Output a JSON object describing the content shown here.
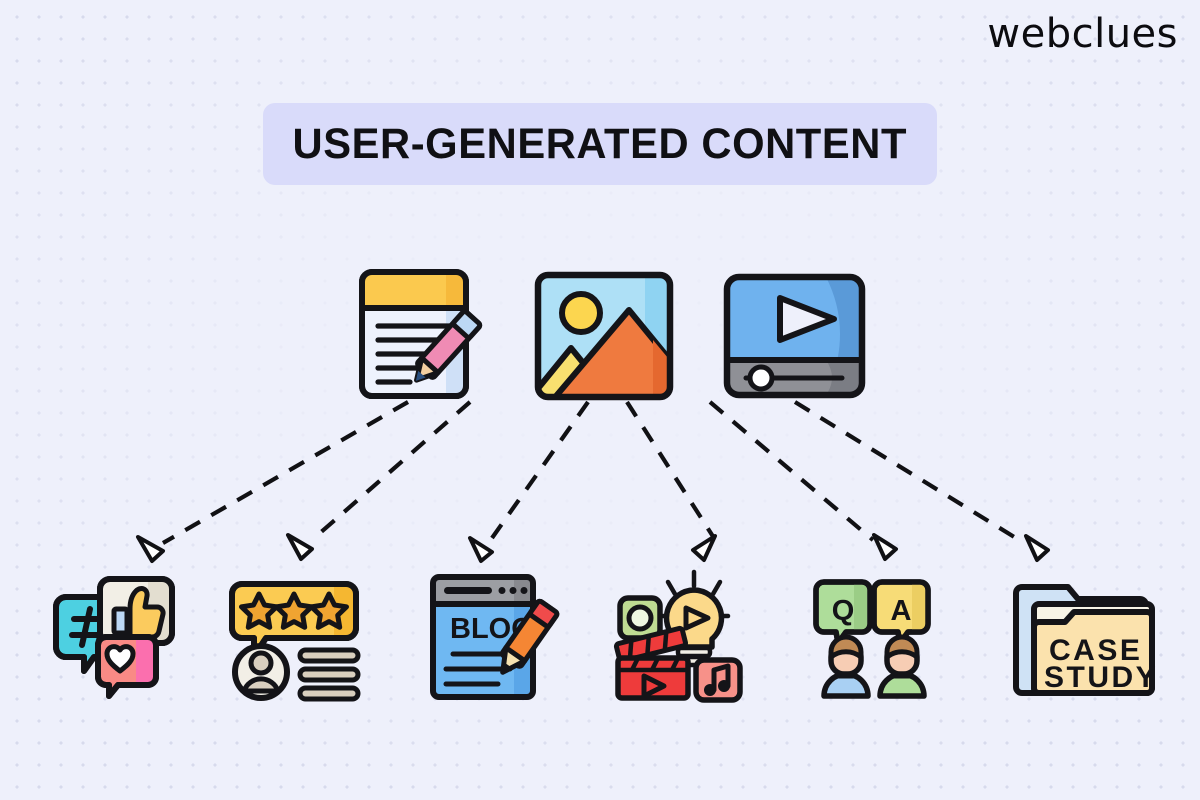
{
  "page": {
    "background_color": "#eef0fb",
    "dot_color": "#d4d7ea"
  },
  "brand": {
    "logo_text": "webclues",
    "logo_color": "#0c0c10"
  },
  "header": {
    "title": "USER-GENERATED CONTENT",
    "pill_color": "#d9dbfa",
    "title_color": "#101014"
  },
  "sources": [
    {
      "id": "text-document",
      "name": "text-document-icon",
      "label": "Text document with pencil",
      "colors": {
        "header": "#fbc94e",
        "page": "#eef2fd",
        "pencil": "#ef8bb4",
        "eraser": "#bcd8f5"
      }
    },
    {
      "id": "image",
      "name": "image-photo-icon",
      "label": "Photo image with mountains and sun",
      "colors": {
        "sky": "#aee0f6",
        "sun": "#fcd64f",
        "mountain_small": "#f8e06f",
        "mountain_large": "#ef7a3f"
      }
    },
    {
      "id": "video",
      "name": "video-player-icon",
      "label": "Video player with play button",
      "colors": {
        "screen": "#6fb2ee",
        "bar": "#8f9096",
        "play": "#eef0fb"
      }
    }
  ],
  "outputs": [
    {
      "id": "social-media",
      "name": "social-media-icon",
      "label": "Social media reactions",
      "colors": {
        "hashtag_bubble": "#4dd0e1",
        "like_bubble": "#f2efe6",
        "thumb": "#fbcb5e",
        "heart_bubble": "#f98a85",
        "heart_accent": "#fb6fae"
      }
    },
    {
      "id": "reviews-ratings",
      "name": "reviews-ratings-icon",
      "label": "Star rating review with user profile",
      "colors": {
        "bubble": "#fbcb52",
        "star": "#f0a431",
        "avatar": "#f2efe6",
        "lines": "#d9cfbf"
      }
    },
    {
      "id": "blog",
      "name": "blog-post-icon",
      "label": "Blog page with pencil",
      "text": "BLOG",
      "colors": {
        "page": "#6fb8f2",
        "browser_bar": "#9c9ea3",
        "pencil": "#f58634",
        "eraser": "#f04b4b"
      }
    },
    {
      "id": "creative-media",
      "name": "creative-media-icon",
      "label": "Clapperboard, lightbulb and music",
      "colors": {
        "lens": "#bfdc93",
        "bulb": "#fbd98a",
        "clapper": "#ee3b3b",
        "music": "#f79189"
      }
    },
    {
      "id": "questions-answers",
      "name": "questions-answers-icon",
      "label": "Question and answer with two people",
      "question_text": "Q",
      "answer_text": "A",
      "colors": {
        "q_bubble": "#aedd9a",
        "a_bubble": "#f7dc77",
        "person_one_shirt": "#a9d0f3",
        "person_two_shirt": "#aedd9a",
        "hair": "#c08a55",
        "skin": "#f7cdb4"
      }
    },
    {
      "id": "case-study",
      "name": "case-study-icon",
      "label": "Case study folder",
      "text_line_1": "CASE",
      "text_line_2": "STUDY",
      "colors": {
        "back_folder": "#cfe2f5",
        "mid_folder": "#f7f4e6",
        "front_folder": "#fbe2ad"
      }
    }
  ],
  "connectors": {
    "style": "dashed",
    "color": "#111114",
    "arrowhead": "hollow-triangle",
    "count": 6,
    "links": [
      {
        "from": "text-document",
        "to": "social-media"
      },
      {
        "from": "text-document",
        "to": "reviews-ratings"
      },
      {
        "from": "image",
        "to": "blog"
      },
      {
        "from": "image",
        "to": "creative-media"
      },
      {
        "from": "video",
        "to": "questions-answers"
      },
      {
        "from": "video",
        "to": "case-study"
      }
    ]
  }
}
